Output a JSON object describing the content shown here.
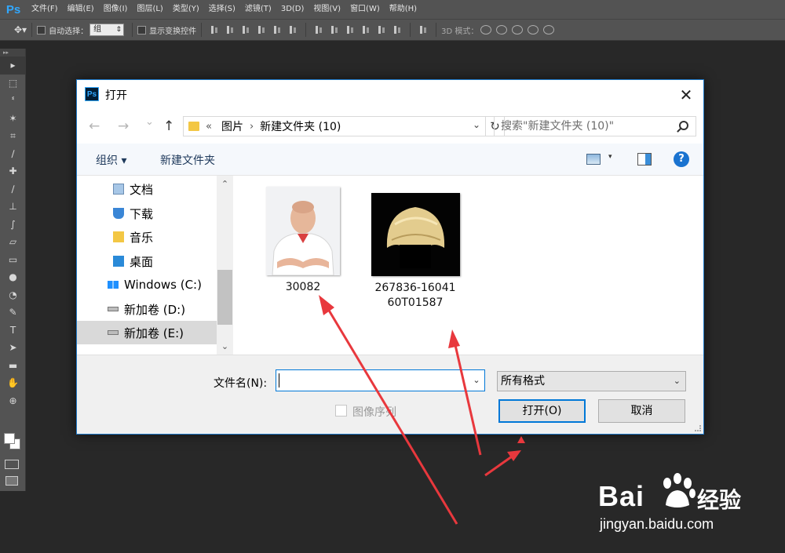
{
  "app": {
    "logo": "Ps",
    "menu": [
      "文件(F)",
      "编辑(E)",
      "图像(I)",
      "图层(L)",
      "类型(Y)",
      "选择(S)",
      "滤镜(T)",
      "3D(D)",
      "视图(V)",
      "窗口(W)",
      "帮助(H)"
    ]
  },
  "options": {
    "auto_select_label": "自动选择：",
    "auto_select_value": "组",
    "show_transform_label": "显示变换控件",
    "mode_3d_label": "3D 模式："
  },
  "toolbar": {
    "collapse_glyph": "▸▸",
    "tools": [
      "move-tool-icon",
      "marquee-tool-icon",
      "lasso-tool-icon",
      "magic-wand-icon",
      "crop-tool-icon",
      "eyedropper-icon",
      "healing-brush-icon",
      "brush-tool-icon",
      "clone-stamp-icon",
      "history-brush-icon",
      "eraser-icon",
      "gradient-tool-icon",
      "blur-tool-icon",
      "dodge-tool-icon",
      "pen-tool-icon",
      "type-tool-icon",
      "path-select-icon",
      "shape-tool-icon",
      "hand-tool-icon",
      "zoom-tool-icon"
    ],
    "type_tool_glyph": "T"
  },
  "dialog": {
    "title": "打开",
    "close": "✕",
    "nav": {
      "back": "←",
      "forward": "→",
      "recent": "⌄",
      "up": "↑"
    },
    "address": {
      "prefix": "«",
      "crumbs": [
        "图片",
        "新建文件夹 (10)"
      ],
      "sep": "›",
      "dropdown": "⌄",
      "refresh": "↻"
    },
    "search_placeholder": "搜索\"新建文件夹 (10)\"",
    "commands": {
      "organize": "组织 ▾",
      "new_folder": "新建文件夹",
      "view_dropdown": "▾",
      "help": "?"
    },
    "nav_pane": {
      "items": [
        {
          "label": "文档",
          "icon": "documents-icon",
          "color": "#a7c7e7"
        },
        {
          "label": "下载",
          "icon": "downloads-icon",
          "color": "#3a86d6"
        },
        {
          "label": "音乐",
          "icon": "music-icon",
          "color": "#f3c744"
        },
        {
          "label": "桌面",
          "icon": "desktop-icon",
          "color": "#2a8ad8"
        },
        {
          "label": "Windows (C:)",
          "icon": "windows-drive-icon",
          "color": "#1e90ff"
        },
        {
          "label": "新加卷 (D:)",
          "icon": "drive-icon",
          "color": "#9a9a9a"
        },
        {
          "label": "新加卷 (E:)",
          "icon": "drive-icon",
          "color": "#9a9a9a"
        }
      ],
      "selected_index": 6,
      "scroll_up": "⌃",
      "scroll_down": "⌄"
    },
    "files": [
      {
        "name": "30082",
        "thumb": "portrait-photo-icon"
      },
      {
        "name_line1": "267836-16041",
        "name_line2": "60T01587",
        "thumb": "wig-photo-icon"
      }
    ],
    "filename_label": "文件名(N):",
    "filename_value": "",
    "filename_dropdown": "⌄",
    "format_value": "所有格式",
    "format_dropdown": "⌄",
    "image_sequence_label": "图像序列",
    "image_sequence_checked": false,
    "open_button": "打开(O)",
    "cancel_button": "取消"
  },
  "watermark": {
    "brand": "Bai",
    "brand_cn": "经验",
    "url": "jingyan.baidu.com"
  },
  "colors": {
    "annotation_arrow": "#e8383d",
    "dialog_border": "#1e79c9",
    "ps_blue": "#31a8ff"
  }
}
